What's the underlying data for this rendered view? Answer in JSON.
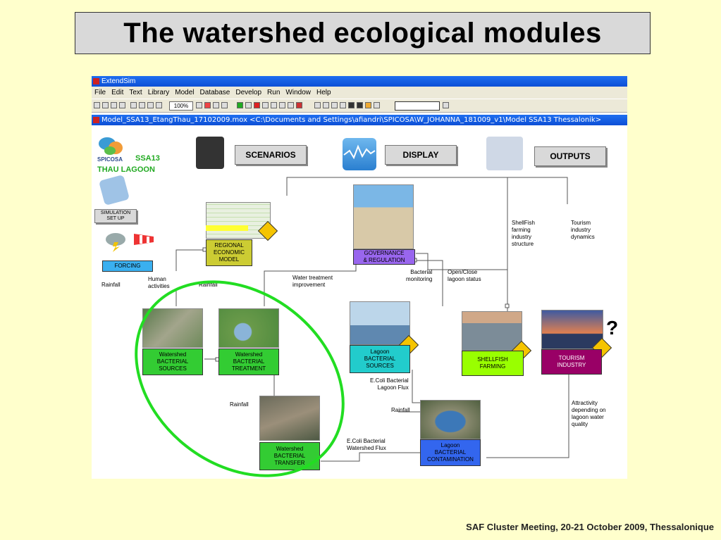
{
  "slide_title": "The watershed ecological modules",
  "footer": "SAF Cluster Meeting, 20-21 October 2009, Thessalonique",
  "app": {
    "window_title": "ExtendSim",
    "menu": [
      "File",
      "Edit",
      "Text",
      "Library",
      "Model",
      "Database",
      "Develop",
      "Run",
      "Window",
      "Help"
    ],
    "zoom": "100%",
    "model_title": "Model_SSA13_EtangThau_17102009.mox    <C:\\Documents and Settings\\afiandri\\SPICOSA\\W_JOHANNA_181009_v1\\Model SSA13 Thessalonik>"
  },
  "brand": {
    "name": "SPICOSA",
    "ssa": "SSA13",
    "site": "THAU LAGOON"
  },
  "top_buttons": {
    "scenarios": "SCENARIOS",
    "display": "DISPLAY",
    "outputs": "OUTPUTS"
  },
  "sim_setup": "SIMULATION\nSET UP",
  "nodes": {
    "forcing": "FORCING",
    "regional": "REGIONAL\nECONOMIC\nMODEL",
    "governance": "GOVERNANCE\n& REGULATION",
    "ws_sources": "Watershed\nBACTERIAL\nSOURCES",
    "ws_treatment": "Watershed\nBACTERIAL\nTREATMENT",
    "lagoon_sources": "Lagoon\nBACTERIAL\nSOURCES",
    "shellfish": "SHELLFISH\nFARMING",
    "tourism": "TOURISM\nINDUSTRY",
    "ws_transfer": "Watershed\nBACTERIAL\nTRANSFER",
    "lagoon_contam": "Lagoon\nBACTERIAL\nCONTAMINATION"
  },
  "labels": {
    "rainfall1": "Rainfall",
    "human": "Human\nactivities",
    "rainfall2": "Rainfall",
    "water_treat": "Water treatment\nimprovement",
    "bact_mon": "Bacterial\nmonitoring",
    "open_close": "Open/Close\nlagoon status",
    "shellfish_struct": "ShellFish\nfarming\nindustry\nstructure",
    "tourism_dyn": "Tourism\nindustry\ndynamics",
    "ecoli_lagoon": "E.Coli Bacterial\nLagoon Flux",
    "rainfall3": "Rainfall",
    "rainfall4": "Rainfall",
    "ecoli_ws": "E.Coli Bacterial\nWatershed Flux",
    "attract": "Attractivity\ndepending on\nlagoon water\nquality",
    "question": "?"
  },
  "colors": {
    "forcing": "#3ab0f0",
    "regional": "#cccc33",
    "governance": "#9966ee",
    "ws": "#33cc33",
    "lagoon_src": "#22cccc",
    "shellfish": "#99ff00",
    "tourism": "#990066",
    "lagoon_contam": "#3366ee",
    "ellipse": "#22dd22"
  }
}
